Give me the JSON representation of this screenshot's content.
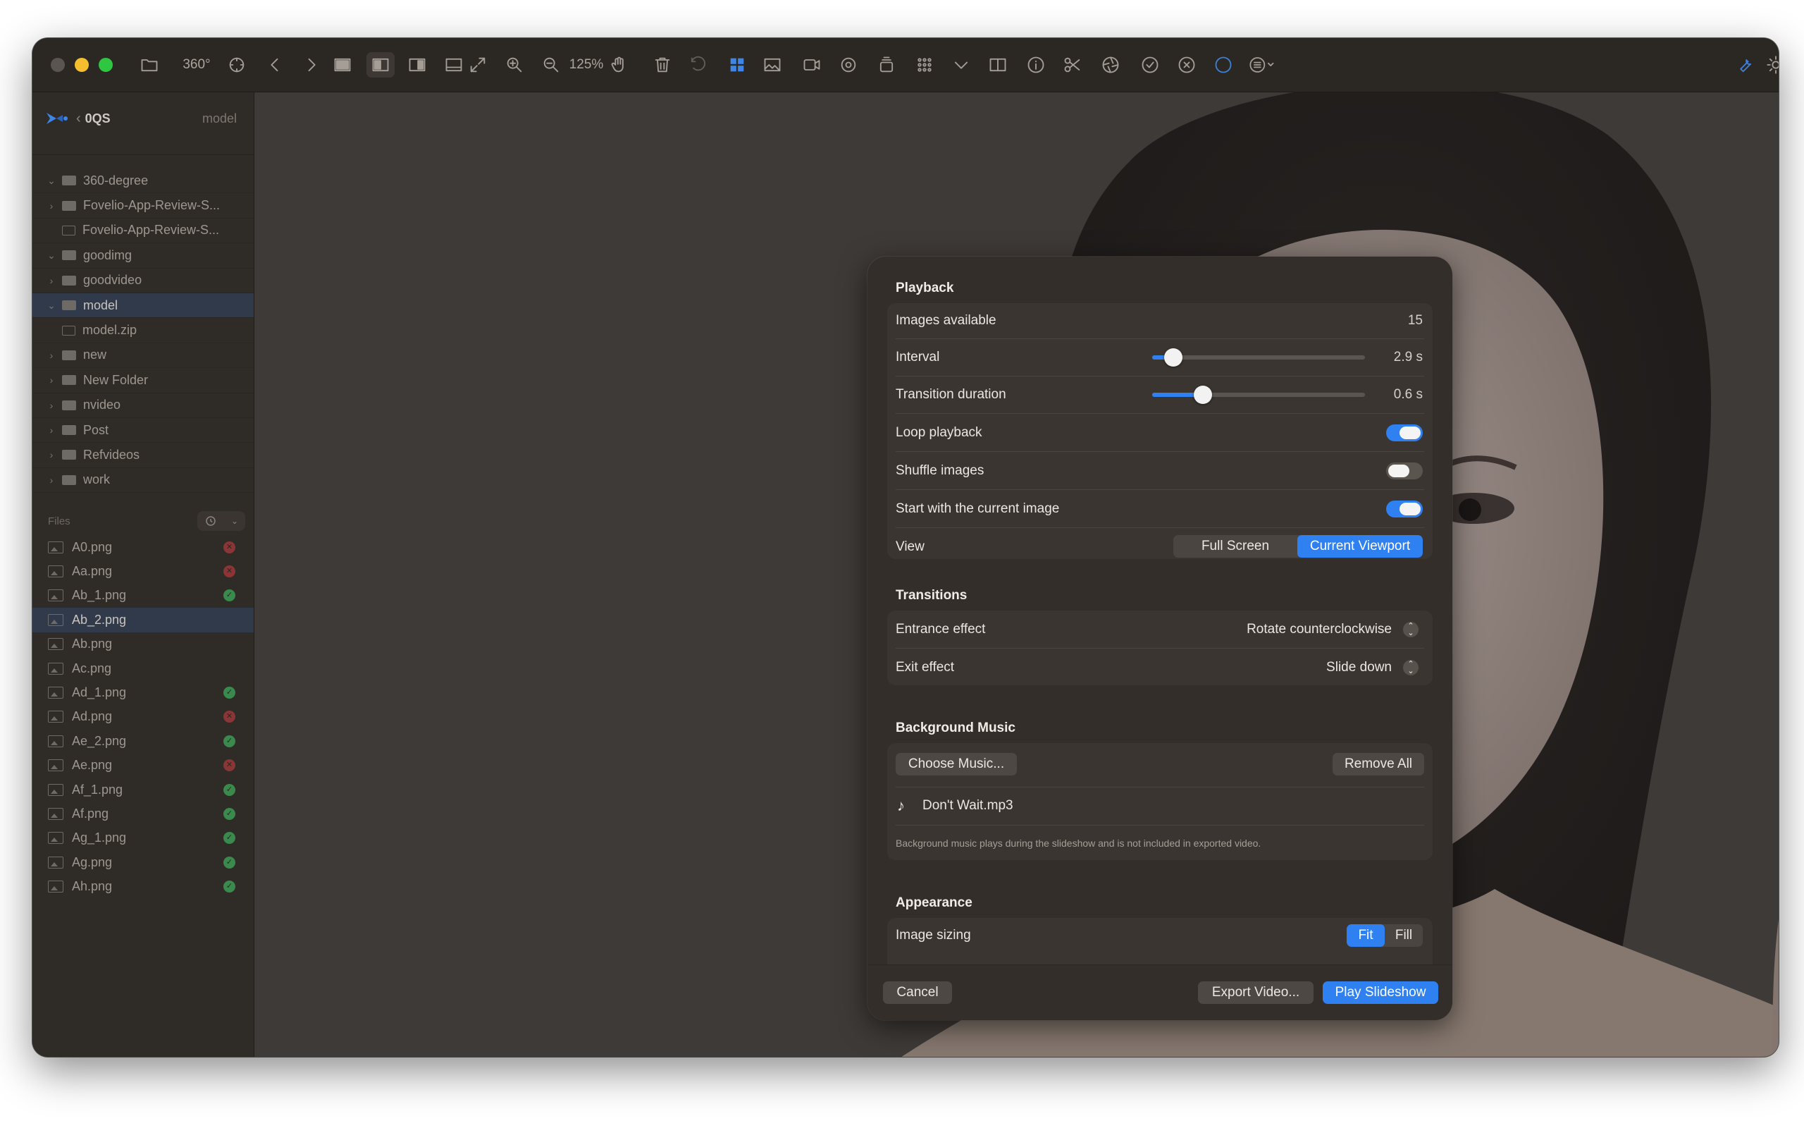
{
  "toolbar": {
    "view_360": "360°",
    "zoom": "125%"
  },
  "sidebar": {
    "title": "0QS",
    "current_folder": "model",
    "folders": [
      {
        "name": "360-degree",
        "chevron": "down",
        "type": "folder"
      },
      {
        "name": "Fovelio-App-Review-S...",
        "chevron": "right",
        "type": "folder"
      },
      {
        "name": "Fovelio-App-Review-S...",
        "chevron": "none",
        "type": "archive"
      },
      {
        "name": "goodimg",
        "chevron": "down",
        "type": "folder"
      },
      {
        "name": "goodvideo",
        "chevron": "right",
        "type": "folder"
      },
      {
        "name": "model",
        "chevron": "down",
        "type": "folder",
        "selected": true
      },
      {
        "name": "model.zip",
        "chevron": "none",
        "type": "archive"
      },
      {
        "name": "new",
        "chevron": "right",
        "type": "folder"
      },
      {
        "name": "New Folder",
        "chevron": "right",
        "type": "folder"
      },
      {
        "name": "nvideo",
        "chevron": "right",
        "type": "folder"
      },
      {
        "name": "Post",
        "chevron": "right",
        "type": "folder"
      },
      {
        "name": "Refvideos",
        "chevron": "right",
        "type": "folder"
      },
      {
        "name": "work",
        "chevron": "right",
        "type": "folder"
      }
    ],
    "files_label": "Files",
    "files": [
      {
        "name": "A0.png",
        "status": "bad"
      },
      {
        "name": "Aa.png",
        "status": "bad"
      },
      {
        "name": "Ab_1.png",
        "status": "ok"
      },
      {
        "name": "Ab_2.png",
        "status": "none",
        "selected": true
      },
      {
        "name": "Ab.png",
        "status": "none"
      },
      {
        "name": "Ac.png",
        "status": "none"
      },
      {
        "name": "Ad_1.png",
        "status": "ok"
      },
      {
        "name": "Ad.png",
        "status": "bad"
      },
      {
        "name": "Ae_2.png",
        "status": "ok"
      },
      {
        "name": "Ae.png",
        "status": "bad"
      },
      {
        "name": "Af_1.png",
        "status": "ok"
      },
      {
        "name": "Af.png",
        "status": "ok"
      },
      {
        "name": "Ag_1.png",
        "status": "ok"
      },
      {
        "name": "Ag.png",
        "status": "ok"
      },
      {
        "name": "Ah.png",
        "status": "ok"
      }
    ]
  },
  "sheet": {
    "playback": {
      "title": "Playback",
      "images_available_label": "Images available",
      "images_available": "15",
      "interval_label": "Interval",
      "interval_value": "2.9 s",
      "interval_fraction": 0.1,
      "transition_label": "Transition duration",
      "transition_value": "0.6 s",
      "transition_fraction": 0.24,
      "loop_label": "Loop playback",
      "loop_on": true,
      "shuffle_label": "Shuffle images",
      "shuffle_on": false,
      "start_current_label": "Start with the current image",
      "start_current_on": true,
      "view_label": "View",
      "view_options": [
        "Full Screen",
        "Current Viewport"
      ],
      "view_selected": "Current Viewport"
    },
    "transitions": {
      "title": "Transitions",
      "entrance_label": "Entrance effect",
      "entrance_value": "Rotate counterclockwise",
      "exit_label": "Exit effect",
      "exit_value": "Slide down"
    },
    "music": {
      "title": "Background Music",
      "choose_label": "Choose Music...",
      "remove_label": "Remove All",
      "track": "Don't Wait.mp3",
      "note": "Background music plays during the slideshow and is not included in exported video."
    },
    "appearance": {
      "title": "Appearance",
      "sizing_label": "Image sizing",
      "sizing_options": [
        "Fit",
        "Fill"
      ],
      "sizing_selected": "Fit"
    },
    "footer": {
      "cancel": "Cancel",
      "export": "Export Video...",
      "play": "Play Slideshow"
    }
  },
  "colors": {
    "accent": "#2f80f0",
    "ok": "#3b8a4d",
    "bad": "#8a3636"
  }
}
